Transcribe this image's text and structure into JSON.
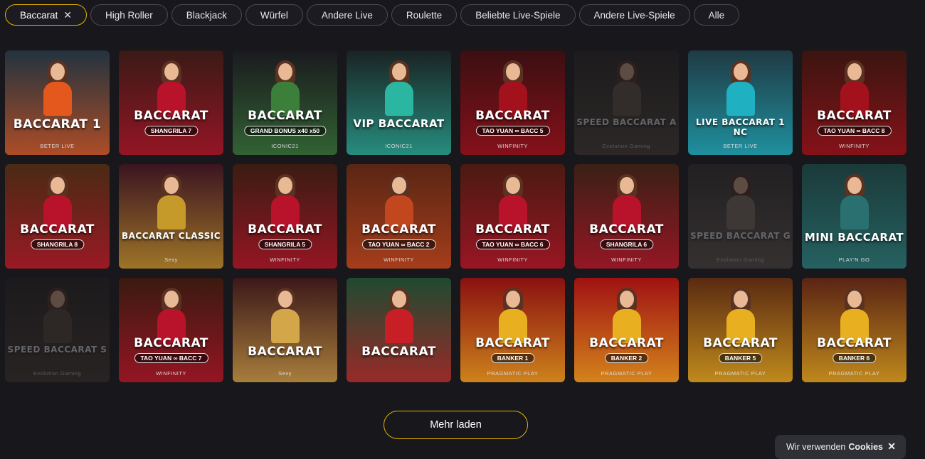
{
  "filters": [
    {
      "label": "Baccarat",
      "active": true
    },
    {
      "label": "High Roller"
    },
    {
      "label": "Blackjack"
    },
    {
      "label": "Würfel"
    },
    {
      "label": "Andere Live"
    },
    {
      "label": "Roulette"
    },
    {
      "label": "Beliebte Live-Spiele"
    },
    {
      "label": "Andere Live-Spiele"
    },
    {
      "label": "Alle"
    }
  ],
  "tiles": [
    {
      "title": "BACCARAT 1",
      "sub": "",
      "brand": "BETER LIVE",
      "bg": "#22333f",
      "accent": "#e4571d",
      "dim": false
    },
    {
      "title": "BACCARAT",
      "sub": "SHANGRILA 7",
      "brand": "",
      "bg": "#3a1a16",
      "accent": "#b8132a",
      "dim": false
    },
    {
      "title": "BACCARAT",
      "sub": "GRAND BONUS x40 x50",
      "brand": "ICONIC21",
      "bg": "#1a1a1f",
      "accent": "#3b7f3a",
      "dim": false
    },
    {
      "title": "VIP BACCARAT",
      "sub": "",
      "brand": "ICONIC21",
      "bg": "#1a2324",
      "accent": "#2bb6a1",
      "dim": false
    },
    {
      "title": "BACCARAT",
      "sub": "TAO YUAN ∞ BACC 5",
      "brand": "WINFINITY",
      "bg": "#3b0f12",
      "accent": "#a3111c",
      "dim": false
    },
    {
      "title": "SPEED BACCARAT A",
      "sub": "",
      "brand": "Evolution Gaming",
      "bg": "#2a2520",
      "accent": "#6b5a4a",
      "dim": true
    },
    {
      "title": "LIVE BACCARAT 1 NC",
      "sub": "",
      "brand": "BETER LIVE",
      "bg": "#1f3b44",
      "accent": "#1fb1c2",
      "dim": false
    },
    {
      "title": "BACCARAT",
      "sub": "TAO YUAN ∞ BACC 8",
      "brand": "WINFINITY",
      "bg": "#3a1510",
      "accent": "#a3111c",
      "dim": false
    },
    {
      "title": "BACCARAT",
      "sub": "SHANGRILA 8",
      "brand": "",
      "bg": "#4a2a14",
      "accent": "#b8132a",
      "dim": false
    },
    {
      "title": "BACCARAT CLASSIC",
      "sub": "",
      "brand": "Sexy",
      "bg": "#3b1421",
      "accent": "#c59a2a",
      "dim": false
    },
    {
      "title": "BACCARAT",
      "sub": "SHANGRILA 5",
      "brand": "WINFINITY",
      "bg": "#3b1c12",
      "accent": "#b8132a",
      "dim": false
    },
    {
      "title": "BACCARAT",
      "sub": "TAO YUAN ∞ BACC 2",
      "brand": "WINFINITY",
      "bg": "#5a2614",
      "accent": "#c2461e",
      "dim": false
    },
    {
      "title": "BACCARAT",
      "sub": "TAO YUAN ∞ BACC 6",
      "brand": "WINFINITY",
      "bg": "#4a1a12",
      "accent": "#b8132a",
      "dim": false
    },
    {
      "title": "BACCARAT",
      "sub": "SHANGRILA 6",
      "brand": "WINFINITY",
      "bg": "#3b2015",
      "accent": "#b8132a",
      "dim": false
    },
    {
      "title": "SPEED BACCARAT G",
      "sub": "",
      "brand": "Evolution Gaming",
      "bg": "#3a3330",
      "accent": "#8a7a6a",
      "dim": true
    },
    {
      "title": "MINI BACCARAT",
      "sub": "",
      "brand": "PLAY'N GO",
      "bg": "#1b3a3a",
      "accent": "#2a7070",
      "dim": false
    },
    {
      "title": "SPEED BACCARAT S",
      "sub": "",
      "brand": "Evolution Gaming",
      "bg": "#2a2220",
      "accent": "#5a4a3a",
      "dim": true
    },
    {
      "title": "BACCARAT",
      "sub": "TAO YUAN ∞ BACC 7",
      "brand": "WINFINITY",
      "bg": "#3a1a10",
      "accent": "#b8132a",
      "dim": false
    },
    {
      "title": "BACCARAT",
      "sub": "",
      "brand": "Sexy",
      "bg": "#3b1818",
      "accent": "#d3a64a",
      "dim": false
    },
    {
      "title": "BACCARAT",
      "sub": "",
      "brand": "",
      "bg": "#1f4a30",
      "accent": "#c81e26",
      "dim": false
    },
    {
      "title": "BACCARAT",
      "sub": "BANKER 1",
      "brand": "PRAGMATIC PLAY",
      "bg": "#8a1010",
      "accent": "#e8b020",
      "dim": false
    },
    {
      "title": "BACCARAT",
      "sub": "BANKER 2",
      "brand": "PRAGMATIC PLAY",
      "bg": "#a01212",
      "accent": "#e8b020",
      "dim": false
    },
    {
      "title": "BACCARAT",
      "sub": "BANKER 5",
      "brand": "PRAGMATIC PLAY",
      "bg": "#5a2a12",
      "accent": "#e8b020",
      "dim": false
    },
    {
      "title": "BACCARAT",
      "sub": "BANKER 6",
      "brand": "PRAGMATIC PLAY",
      "bg": "#5a2414",
      "accent": "#e8b020",
      "dim": false
    }
  ],
  "load_more": "Mehr laden",
  "cookie": {
    "text": "Wir verwenden",
    "bold": "Cookies"
  }
}
